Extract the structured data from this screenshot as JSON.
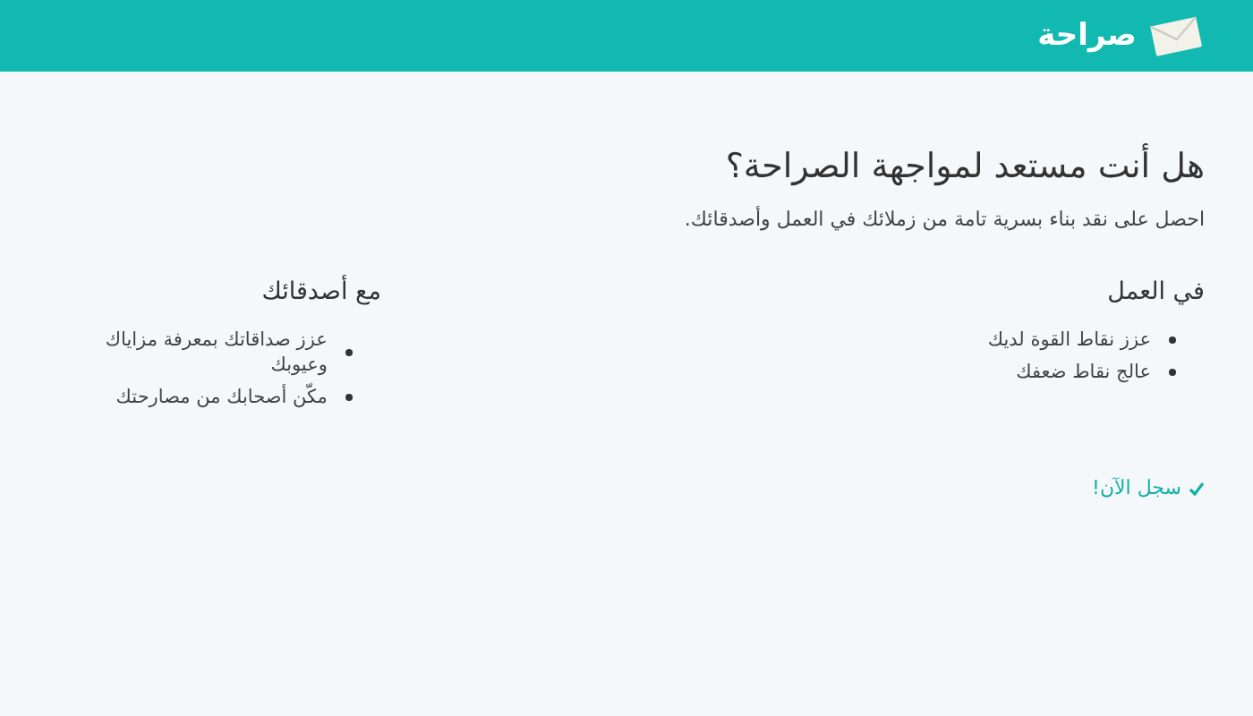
{
  "header": {
    "brand": "صراحة"
  },
  "hero": {
    "title": "هل أنت مستعد لمواجهة الصراحة؟",
    "subtitle": "احصل على نقد بناء بسرية تامة من زملائك في العمل وأصدقائك."
  },
  "sections": [
    {
      "heading": "في العمل",
      "items": [
        "عزز نقاط القوة لديك",
        "عالج نقاط ضعفك"
      ]
    },
    {
      "heading": "مع أصدقائك",
      "items": [
        "عزز صداقاتك بمعرفة مزاياك وعيوبك",
        "مكّن أصحابك من مصارحتك"
      ]
    }
  ],
  "cta": {
    "label": "سجل الآن!"
  }
}
